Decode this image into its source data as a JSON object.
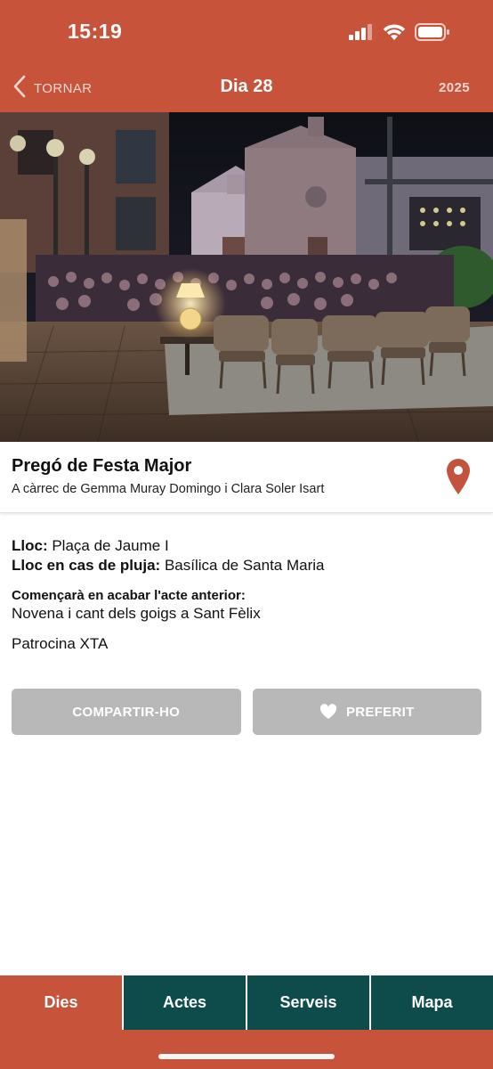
{
  "status_bar": {
    "time": "15:19"
  },
  "nav": {
    "back_label": "TORNAR",
    "title": "Dia 28",
    "year": "2025"
  },
  "event": {
    "title": "Pregó de Festa Major",
    "subtitle": "A càrrec de Gemma Muray Domingo i Clara Soler Isart"
  },
  "details": {
    "place_label": "Lloc:",
    "place_value": "Plaça de Jaume I",
    "rain_label": "Lloc en cas de pluja:",
    "rain_value": "Basílica de Santa Maria",
    "start_label": "Començarà en acabar l'acte anterior:",
    "start_value": "Novena i cant dels goigs a Sant Fèlix",
    "sponsor": "Patrocina XTA"
  },
  "actions": {
    "share_label": "COMPARTIR-HO",
    "favorite_label": "PREFERIT"
  },
  "tabs": [
    {
      "label": "Dies"
    },
    {
      "label": "Actes"
    },
    {
      "label": "Serveis"
    },
    {
      "label": "Mapa"
    }
  ],
  "colors": {
    "brand": "#c7533b",
    "tab_dark": "#0e4b4b",
    "button_gray": "#b8b8b8",
    "pin": "#c4533e"
  },
  "icons": [
    "signal-icon",
    "wifi-icon",
    "battery-icon",
    "chevron-left-icon",
    "location-pin-icon",
    "heart-icon"
  ]
}
